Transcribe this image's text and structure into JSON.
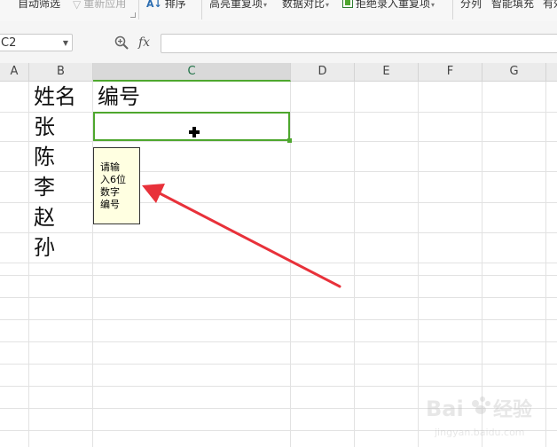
{
  "ribbon": {
    "auto_filter": "自动筛选",
    "reapply": "重新应用",
    "sort": "排序",
    "highlight_duplicates": "高亮重复项",
    "data_compare": "数据对比",
    "reject_duplicates": "拒绝录入重复项",
    "split_column": "分列",
    "smart_fill": "智能填充",
    "truncated": "有效"
  },
  "formula_bar": {
    "name_box": "C2",
    "fx_label": "fx",
    "value": ""
  },
  "columns": [
    "A",
    "B",
    "C",
    "D",
    "E",
    "F",
    "G"
  ],
  "selected_column": "C",
  "cells": {
    "B1": "姓名",
    "C1": "编号",
    "B2": "张",
    "B3": "陈",
    "B4": "李",
    "B5": "赵",
    "B6": "孙"
  },
  "tooltip": {
    "line1": "请输",
    "line2": "入6位",
    "line3": "数字",
    "line4": "编号"
  },
  "colors": {
    "selection_green": "#4ea72e",
    "arrow_red": "#e8313a",
    "tooltip_bg": "#ffffe1"
  },
  "icons": [
    "sort-icon",
    "highlight-duplicates-icon",
    "reject-duplicates-icon",
    "zoom-icon",
    "crosshair-cursor-icon"
  ]
}
